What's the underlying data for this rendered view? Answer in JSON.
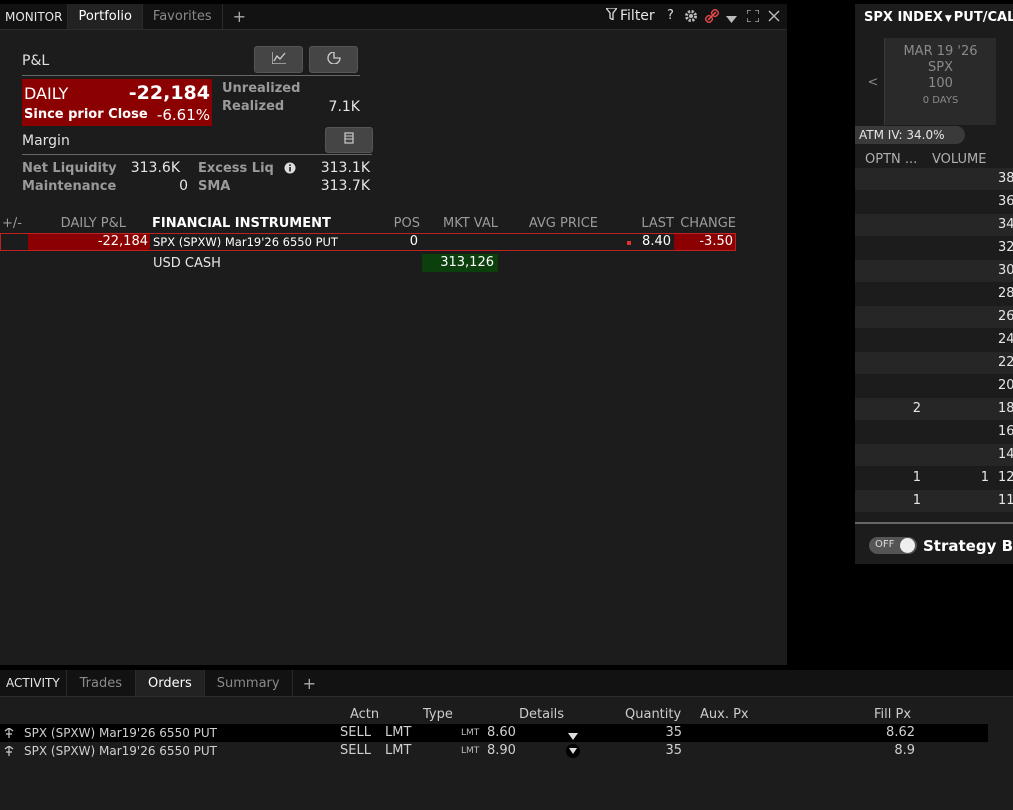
{
  "monitor": {
    "section_label": "MONITOR",
    "tabs": [
      {
        "label": "Portfolio"
      },
      {
        "label": "Favorites"
      }
    ],
    "add_tab": "+",
    "filter_label": "Filter",
    "help": "?"
  },
  "pnl": {
    "title": "P&L",
    "daily_label": "DAILY",
    "daily_value": "-22,184",
    "since_label": "Since prior Close",
    "since_value": "-6.61%",
    "unrealized_label": "Unrealized",
    "unrealized_value": "",
    "realized_label": "Realized",
    "realized_value": "7.1K",
    "daily_bg": "#8b0000"
  },
  "margin": {
    "title": "Margin",
    "net_liq_label": "Net Liquidity",
    "net_liq_value": "313.6K",
    "excess_liq_label": "Excess Liq",
    "excess_liq_value": "313.1K",
    "maintenance_label": "Maintenance",
    "maintenance_value": "0",
    "sma_label": "SMA",
    "sma_value": "313.7K"
  },
  "portfolio_table": {
    "headers": {
      "plusminus": "+/-",
      "daily_pnl": "DAILY P&L",
      "instrument": "FINANCIAL INSTRUMENT",
      "pos": "POS",
      "mkt_val": "MKT VAL",
      "avg_price": "AVG PRICE",
      "last": "LAST",
      "change": "CHANGE"
    },
    "rows": [
      {
        "daily_pnl": "-22,184",
        "instrument": "SPX (SPXW) Mar19'26 6550 PUT",
        "pos": "0",
        "mkt_val": "",
        "avg_price": "",
        "last": "8.40",
        "change": "-3.50"
      },
      {
        "daily_pnl": "",
        "instrument": "USD CASH",
        "pos": "",
        "mkt_val": "313,126",
        "avg_price": "",
        "last": "",
        "change": ""
      }
    ]
  },
  "option_chain": {
    "symbol": "SPX INDEX",
    "mode": "PUT/CAL",
    "expiry": {
      "date": "MAR 19 '26",
      "underlying": "SPX",
      "multiplier": "100",
      "days": "0 DAYS"
    },
    "prev_arrow": "<",
    "atm_iv": "ATM IV: 34.0%",
    "col_optn": "OPTN ...",
    "col_volume": "VOLUME",
    "rows": [
      {
        "optn": "",
        "volume": "",
        "strike": "38"
      },
      {
        "optn": "",
        "volume": "",
        "strike": "36"
      },
      {
        "optn": "",
        "volume": "",
        "strike": "34"
      },
      {
        "optn": "",
        "volume": "",
        "strike": "32"
      },
      {
        "optn": "",
        "volume": "",
        "strike": "30"
      },
      {
        "optn": "",
        "volume": "",
        "strike": "28"
      },
      {
        "optn": "",
        "volume": "",
        "strike": "26"
      },
      {
        "optn": "",
        "volume": "",
        "strike": "24"
      },
      {
        "optn": "",
        "volume": "",
        "strike": "22"
      },
      {
        "optn": "",
        "volume": "",
        "strike": "20"
      },
      {
        "optn": "2",
        "volume": "",
        "strike": "18"
      },
      {
        "optn": "",
        "volume": "",
        "strike": "16"
      },
      {
        "optn": "",
        "volume": "",
        "strike": "14"
      },
      {
        "optn": "1",
        "volume": "1",
        "strike": "12"
      },
      {
        "optn": "1",
        "volume": "",
        "strike": "11"
      }
    ],
    "toggle_label": "OFF",
    "strategy_label": "Strategy Bu"
  },
  "activity": {
    "section_label": "ACTIVITY",
    "tabs": [
      {
        "label": "Trades"
      },
      {
        "label": "Orders"
      },
      {
        "label": "Summary"
      }
    ],
    "add_tab": "+",
    "headers": {
      "actn": "Actn",
      "type": "Type",
      "details": "Details",
      "quantity": "Quantity",
      "aux": "Aux. Px",
      "fill": "Fill Px"
    },
    "orders": [
      {
        "instrument": "SPX (SPXW) Mar19'26 6550 PUT",
        "actn": "SELL",
        "type": "LMT",
        "details_type": "LMT",
        "details_price": "8.60",
        "quantity": "35",
        "fill": "8.62"
      },
      {
        "instrument": "SPX (SPXW) Mar19'26 6550 PUT",
        "actn": "SELL",
        "type": "LMT",
        "details_type": "LMT",
        "details_price": "8.90",
        "quantity": "35",
        "fill": "8.9"
      }
    ]
  }
}
